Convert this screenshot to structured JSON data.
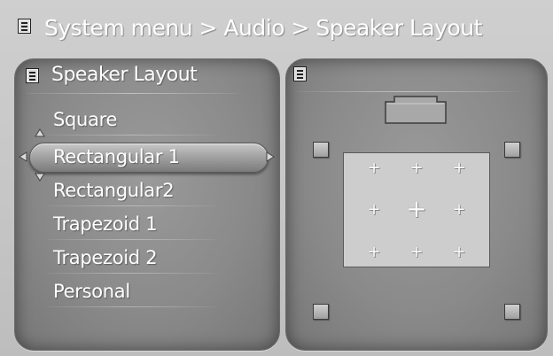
{
  "header": {
    "breadcrumb": "System menu > Audio > Speaker Layout"
  },
  "left_panel": {
    "title": "Speaker Layout",
    "options": [
      {
        "label": "Square"
      },
      {
        "label": "Rectangular 1"
      },
      {
        "label": "Rectangular2"
      },
      {
        "label": "Trapezoid 1"
      },
      {
        "label": "Trapezoid 2"
      },
      {
        "label": "Personal"
      }
    ],
    "selected_label": "Rectangular 1"
  },
  "right_panel": {
    "icon": "menu-icon",
    "listener_markers": [
      "+",
      "+",
      "+",
      "+",
      "+",
      "+",
      "+",
      "+",
      "+"
    ]
  }
}
